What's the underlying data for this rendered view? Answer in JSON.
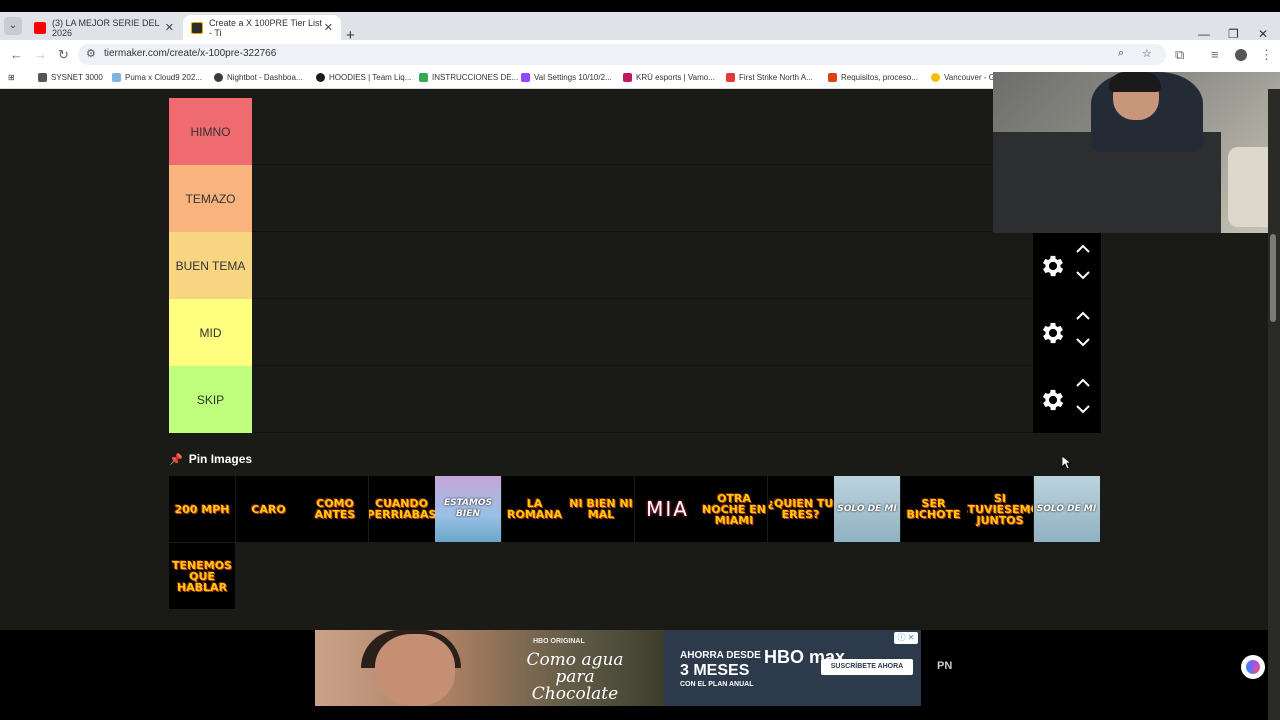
{
  "browser": {
    "tabs": [
      {
        "title": "(3) LA MEJOR SERIE DEL 2026 ",
        "favicon_color": "#ff0000",
        "active": false
      },
      {
        "title": "Create a X 100PRE Tier List - Ti",
        "favicon_color": "#2b2b2b",
        "active": true
      }
    ],
    "url": "tiermaker.com/create/x-100pre-322766",
    "bookmarks": [
      {
        "label": "SYSNET 3000",
        "color": "#555555"
      },
      {
        "label": "Puma x Cloud9 202...",
        "color": "#7fb3e0"
      },
      {
        "label": "Nightbot - Dashboa...",
        "color": "#3a3a3a"
      },
      {
        "label": "HOODIES | Team Liq...",
        "color": "#1a1a1a"
      },
      {
        "label": "INSTRUCCIONES DE...",
        "color": "#34a853"
      },
      {
        "label": "Val Settings 10/10/2...",
        "color": "#9146ff"
      },
      {
        "label": "KRÜ esports | Vamo...",
        "color": "#c2185b"
      },
      {
        "label": "First Strike North A...",
        "color": "#e53935"
      },
      {
        "label": "Requisitos, proceso...",
        "color": "#d84315"
      },
      {
        "label": "Vancouver - G",
        "color": "#fbbc04"
      }
    ]
  },
  "tiers": [
    {
      "label": "HIMNO",
      "color": "#f06b6f"
    },
    {
      "label": "TEMAZO",
      "color": "#f8b37e"
    },
    {
      "label": "BUEN TEMA",
      "color": "#f8d681"
    },
    {
      "label": "MID",
      "color": "#ffff7f"
    },
    {
      "label": "SKIP",
      "color": "#c0fe7e"
    }
  ],
  "pin_section": {
    "label": "Pin Images",
    "icon": "pin-icon"
  },
  "pool_items": [
    {
      "title": "200 MPH",
      "style": "text",
      "color": "#ffcc00"
    },
    {
      "title": "CARO",
      "style": "text",
      "color": "#ffcc00"
    },
    {
      "title": "COMO ANTES",
      "style": "text",
      "color": "#ffcc00"
    },
    {
      "title": "CUANDO PERRIABAS",
      "style": "text",
      "color": "#ffcc00"
    },
    {
      "title": "ESTAMOS BIEN",
      "style": "photo",
      "color": "#ffffff"
    },
    {
      "title": "LA ROMANA",
      "style": "text",
      "color": "#ffcc00"
    },
    {
      "title": "NI BIEN NI MAL",
      "style": "text",
      "color": "#ffcc00"
    },
    {
      "title": "MIA",
      "style": "outline",
      "color": "#ffffff"
    },
    {
      "title": "OTRA NOCHE EN MIAMI",
      "style": "text",
      "color": "#ffcc00"
    },
    {
      "title": "¿QUIEN TU ERES?",
      "style": "text",
      "color": "#ffcc00"
    },
    {
      "title": "SOLO DE MI",
      "style": "photo2",
      "color": "#ffffff"
    },
    {
      "title": "SER BICHOTE",
      "style": "text",
      "color": "#ffcc00"
    },
    {
      "title": "SI ESTUVIESEMOS JUNTOS",
      "style": "text",
      "color": "#ffcc00"
    },
    {
      "title": "SOLO DE MI",
      "style": "photo2",
      "color": "#ffffff"
    },
    {
      "title": "TENEMOS QUE HABLAR",
      "style": "text",
      "color": "#ffcc00"
    }
  ],
  "ad": {
    "brand": "HBO ORIGINAL",
    "title": "Como agua para Chocolate",
    "promo_line1": "AHORRA DESDE",
    "promo_line2": "3 MESES",
    "promo_line3": "CON EL PLAN ANUAL",
    "logo": "HBO max",
    "cta": "SUSCRÍBETE AHORA",
    "side_text": "PN"
  }
}
